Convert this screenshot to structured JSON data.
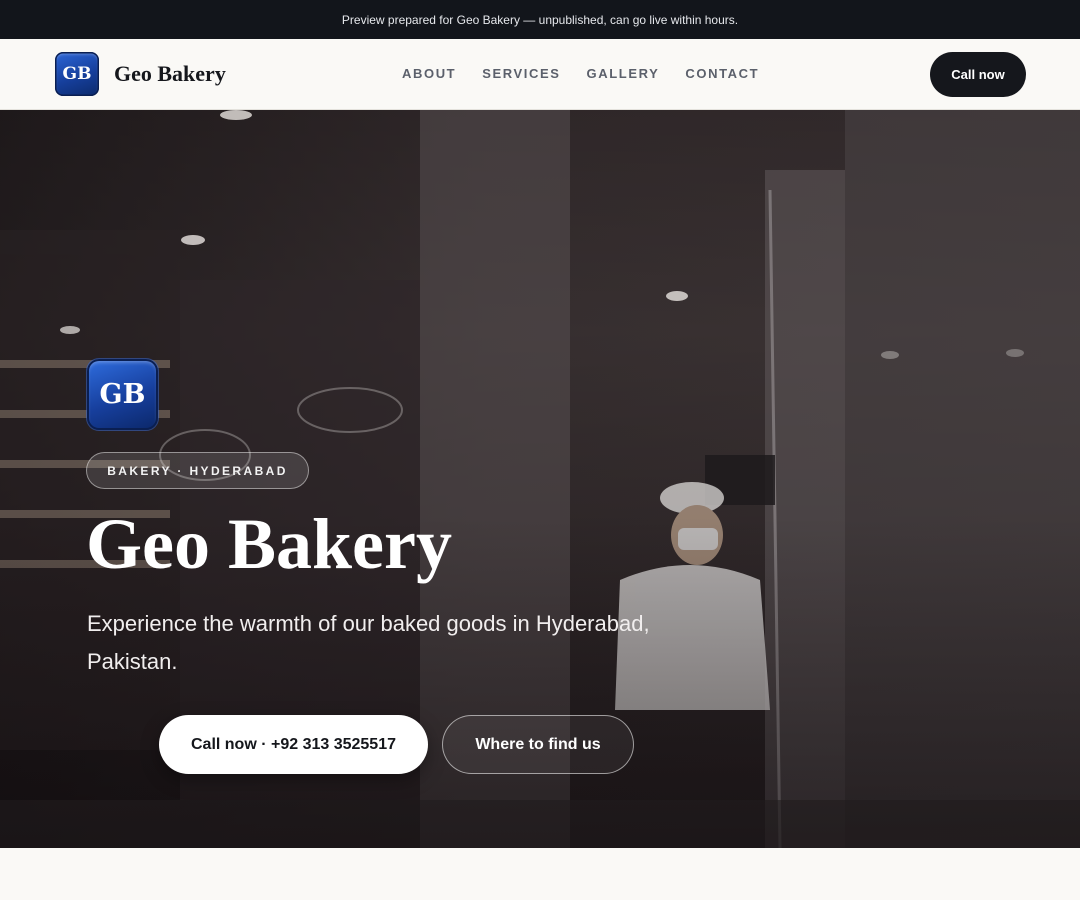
{
  "preview_bar": {
    "text": "Preview prepared for Geo Bakery — unpublished, can go live within hours."
  },
  "header": {
    "logo_text": "GB",
    "brand_name": "Geo Bakery",
    "nav": [
      "ABOUT",
      "SERVICES",
      "GALLERY",
      "CONTACT"
    ],
    "call_label": "Call now"
  },
  "hero": {
    "badge_text": "GB",
    "tag": "BAKERY · HYDERABAD",
    "title": "Geo Bakery",
    "subtitle": "Experience the warmth of our baked goods in Hyderabad, Pakistan.",
    "primary_button": "Call now · +92 313 3525517",
    "secondary_button": "Where to find us"
  },
  "colors": {
    "dark": "#15171c",
    "badge_blue": "#173f9d",
    "page_bg": "#faf9f6"
  }
}
